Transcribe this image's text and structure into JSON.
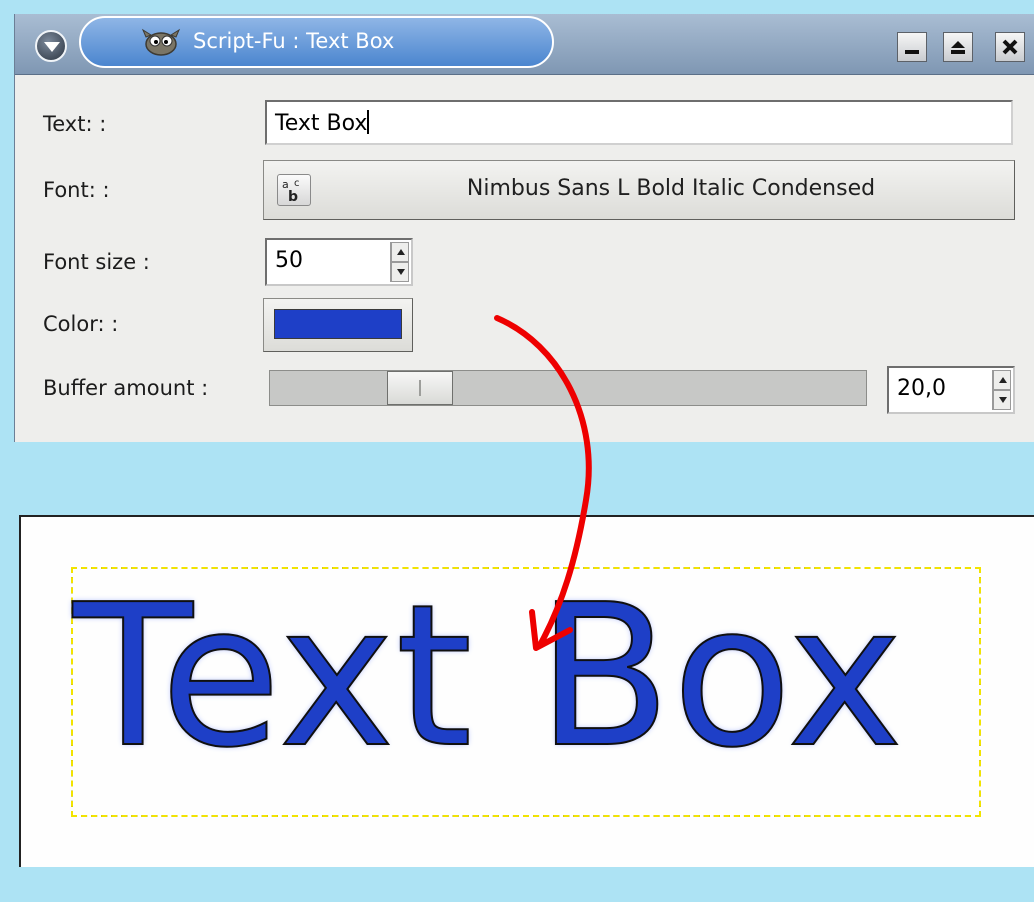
{
  "window": {
    "title": "Script-Fu : Text Box",
    "menu_icon": "chevron-down-icon",
    "app_icon": "gimp-icon",
    "controls": [
      "minimize-icon",
      "maximize-icon",
      "close-icon"
    ]
  },
  "form": {
    "text_label": "Text: :",
    "text_value": "Text Box",
    "font_label": "Font: :",
    "font_icon": "font-preview-icon",
    "font_value": "Nimbus Sans L Bold Italic Condensed",
    "font_size_label": "Font size :",
    "font_size_value": "50",
    "color_label": "Color: :",
    "color_value": "#1e3fc7",
    "buffer_label": "Buffer amount :",
    "buffer_value": "20,0",
    "buffer_fraction": 0.22
  },
  "canvas": {
    "text": "Text Box",
    "text_color": "#1e3fc7"
  },
  "colors": {
    "desktop": "#ade3f4",
    "dialog_bg": "#eeeeec",
    "annotation_arrow": "#ee0000"
  }
}
